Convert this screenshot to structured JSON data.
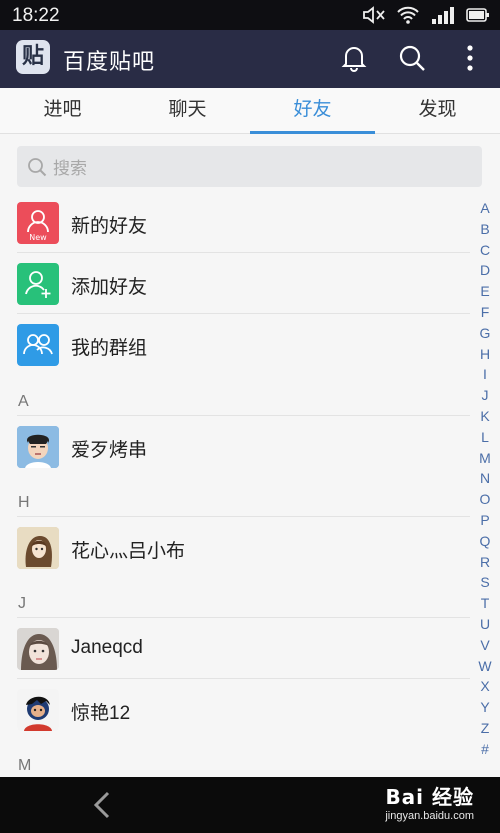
{
  "status_bar": {
    "time": "18:22"
  },
  "app_bar": {
    "logo_char": "贴",
    "title": "百度贴吧"
  },
  "tabs": [
    {
      "label": "进吧",
      "active": false
    },
    {
      "label": "聊天",
      "active": false
    },
    {
      "label": "好友",
      "active": true
    },
    {
      "label": "发现",
      "active": false
    }
  ],
  "search": {
    "placeholder": "搜索"
  },
  "functions": [
    {
      "label": "新的好友",
      "icon": "new-friend-icon",
      "color": "#ec4d5a",
      "badge": "New"
    },
    {
      "label": "添加好友",
      "icon": "add-friend-icon",
      "color": "#28c17a"
    },
    {
      "label": "我的群组",
      "icon": "group-icon",
      "color": "#2f9be6"
    }
  ],
  "sections": [
    {
      "letter": "A",
      "friends": [
        {
          "name": "爱歹烤串"
        }
      ]
    },
    {
      "letter": "H",
      "friends": [
        {
          "name": "花心灬吕小布"
        }
      ]
    },
    {
      "letter": "J",
      "friends": [
        {
          "name": "Janeqcd"
        },
        {
          "name": "惊艳12"
        }
      ]
    },
    {
      "letter": "M",
      "friends": []
    }
  ],
  "index_letters": [
    "A",
    "B",
    "C",
    "D",
    "E",
    "F",
    "G",
    "H",
    "I",
    "J",
    "K",
    "L",
    "M",
    "N",
    "O",
    "P",
    "Q",
    "R",
    "S",
    "T",
    "U",
    "V",
    "W",
    "X",
    "Y",
    "Z",
    "#"
  ],
  "watermark": {
    "text": "Bai 经验",
    "sub": "jingyan.baidu.com"
  },
  "colors": {
    "app_bar": "#292c45",
    "accent": "#3a8ed8",
    "index": "#4b6ea8"
  }
}
